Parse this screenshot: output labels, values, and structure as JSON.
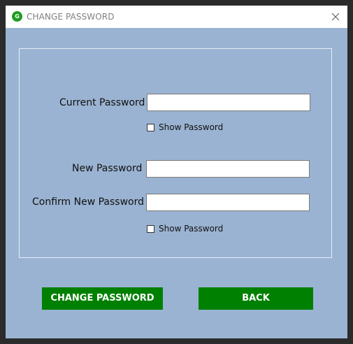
{
  "window": {
    "title": "CHANGE PASSWORD",
    "icon": "app-logo-icon",
    "icon_text": "G",
    "close_icon": "close-icon"
  },
  "form": {
    "current_password": {
      "label": "Current Password",
      "value": "",
      "placeholder": ""
    },
    "show_password_1": {
      "label": "Show Password",
      "checked": false
    },
    "new_password": {
      "label": "New Password",
      "value": "",
      "placeholder": ""
    },
    "confirm_new_password": {
      "label": "Confirm New Password",
      "value": "",
      "placeholder": ""
    },
    "show_password_2": {
      "label": "Show Password",
      "checked": false
    }
  },
  "buttons": {
    "change_password": "CHANGE PASSWORD",
    "back": "BACK"
  },
  "colors": {
    "background": "#9ab3d2",
    "titlebar": "#ffffff",
    "button": "#008000",
    "button_text": "#ffffff",
    "app_icon": "#1f9c1f"
  }
}
